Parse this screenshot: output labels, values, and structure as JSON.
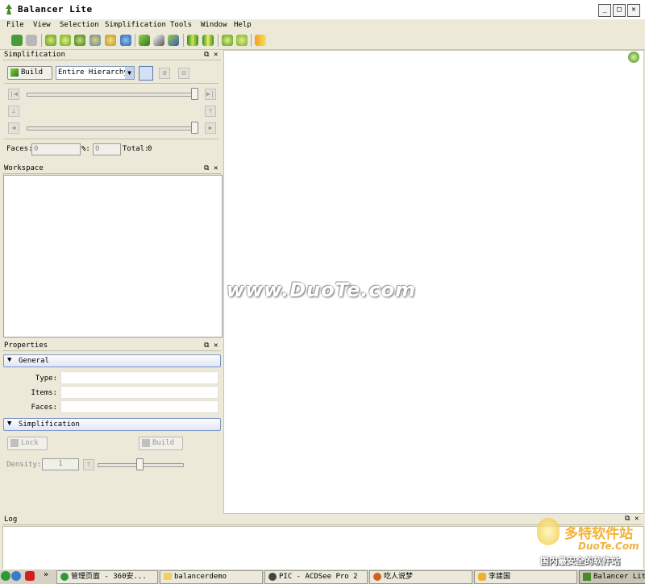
{
  "window": {
    "title": "Balancer Lite",
    "min": "_",
    "max": "□",
    "close": "✕"
  },
  "menu": [
    "File",
    "View",
    "Selection",
    "Simplification",
    "Tools",
    "Window",
    "Help"
  ],
  "simplification": {
    "header": "Simplification",
    "build_label": "Build",
    "scope_value": "Entire Hierarchy",
    "faces_label": "Faces:",
    "faces_value": "0",
    "percent_label": "%:",
    "percent_value": "0",
    "total_label": "Total:",
    "total_value": "0"
  },
  "workspace": {
    "header": "Workspace"
  },
  "properties": {
    "header": "Properties",
    "general_label": "General",
    "rows": [
      {
        "label": "Type:"
      },
      {
        "label": "Items:"
      },
      {
        "label": "Faces:"
      }
    ],
    "simplification_label": "Simplification",
    "lock_label": "Lock",
    "build_label": "Build",
    "density_label": "Density:",
    "density_value": "1"
  },
  "viewport": {
    "watermark": "www.DuoTe.com"
  },
  "log": {
    "header": "Log"
  },
  "corner_logo": {
    "brand": "多特软件站",
    "url": "DuoTe.Com",
    "tagline": "国内最安全的软件站"
  },
  "taskbar": {
    "chevron": "»",
    "tasks": [
      "管理页面 - 360安...",
      "balancerdemo",
      "PIC - ACDSee Pro 2",
      "吃人说梦",
      "李建国",
      "Balancer Lite"
    ]
  }
}
